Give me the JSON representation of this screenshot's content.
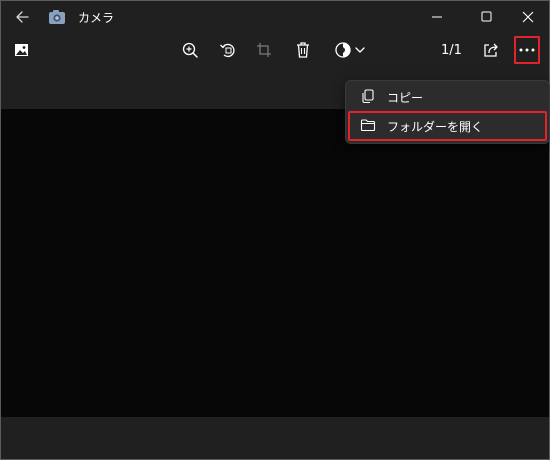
{
  "app": {
    "title": "カメラ"
  },
  "titlebar": {
    "back_icon": "arrow-left-icon",
    "app_icon": "camera-icon",
    "minimize_icon": "minimize-icon",
    "maximize_icon": "maximize-icon",
    "close_icon": "close-icon"
  },
  "toolbar": {
    "items": [
      {
        "name": "image-thumbnail",
        "icon": "image-icon"
      },
      {
        "name": "zoom-in",
        "icon": "zoom-in-icon"
      },
      {
        "name": "rotate",
        "icon": "rotate-icon"
      },
      {
        "name": "crop",
        "icon": "crop-icon"
      },
      {
        "name": "delete",
        "icon": "trash-icon"
      },
      {
        "name": "edit",
        "icon": "edit-icon"
      },
      {
        "name": "share",
        "icon": "share-icon"
      },
      {
        "name": "more",
        "icon": "more-icon"
      }
    ],
    "counter": "1/1"
  },
  "context_menu": {
    "items": [
      {
        "label": "コピー",
        "icon": "copy-icon"
      },
      {
        "label": "フォルダーを開く",
        "icon": "folder-icon"
      }
    ]
  },
  "colors": {
    "background": "#202020",
    "content": "#070707",
    "menu": "#2c2c2c",
    "highlight": "#e0242a"
  }
}
